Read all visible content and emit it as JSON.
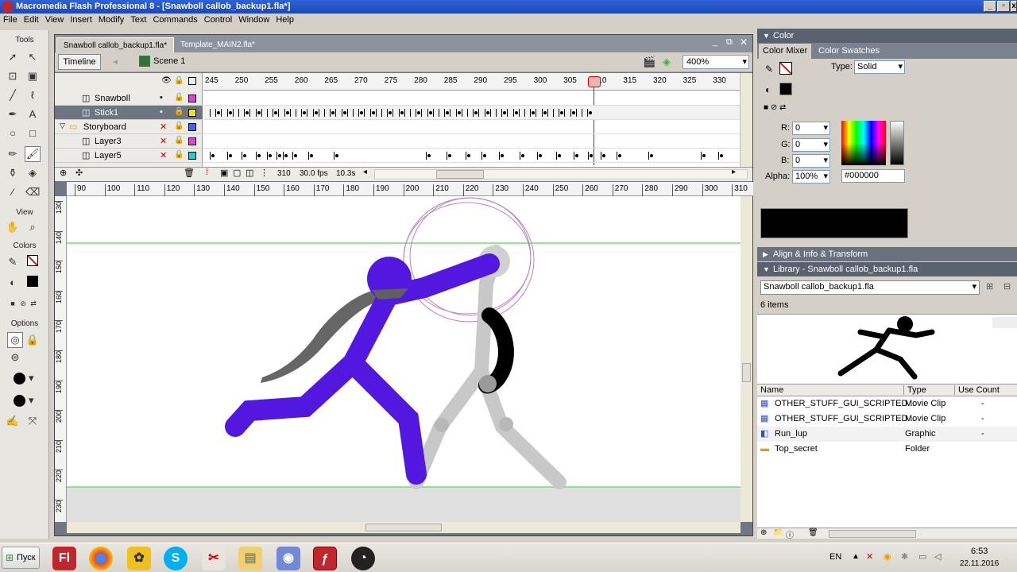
{
  "app": {
    "title": "Macromedia Flash Professional 8 - [Snawboll callob_backup1.fla*]",
    "window_controls": [
      "_",
      "▫",
      "x"
    ]
  },
  "menu": [
    "File",
    "Edit",
    "View",
    "Insert",
    "Modify",
    "Text",
    "Commands",
    "Control",
    "Window",
    "Help"
  ],
  "tools": {
    "label": "Tools",
    "view_label": "View",
    "colors_label": "Colors",
    "options_label": "Options"
  },
  "doc_tabs": [
    "Snawboll callob_backup1.fla*",
    "Template_MAIN2.fla*"
  ],
  "edit_bar": {
    "timeline_button": "Timeline",
    "scene": "Scene 1",
    "zoom": "400%"
  },
  "timeline": {
    "frame_numbers": [
      "245",
      "250",
      "255",
      "260",
      "265",
      "270",
      "275",
      "280",
      "285",
      "290",
      "295",
      "300",
      "305",
      "310",
      "315",
      "320",
      "325",
      "330"
    ],
    "layers": [
      {
        "name": "Snawboll",
        "color": "#e040e0",
        "type": "layer"
      },
      {
        "name": "Stick1",
        "color": "#f0e020",
        "type": "layer",
        "selected": true
      },
      {
        "name": "Storyboard",
        "color": "#4060ff",
        "type": "folder"
      },
      {
        "name": "Layer3",
        "color": "#e040e0",
        "type": "layer"
      },
      {
        "name": "Layer5",
        "color": "#20d0d0",
        "type": "layer"
      }
    ],
    "current_frame": "310",
    "fps": "30.0 fps",
    "time": "10.3s"
  },
  "ruler": {
    "h_ticks": [
      "90",
      "100",
      "110",
      "120",
      "130",
      "140",
      "150",
      "160",
      "170",
      "180",
      "190",
      "200",
      "210",
      "220",
      "230",
      "240",
      "250",
      "260",
      "270",
      "280",
      "290",
      "300",
      "310"
    ],
    "v_ticks": [
      "130",
      "140",
      "150",
      "160",
      "170",
      "180",
      "190",
      "200",
      "210",
      "220",
      "230"
    ]
  },
  "color_panel": {
    "title": "Color",
    "tabs": [
      "Color Mixer",
      "Color Swatches"
    ],
    "type_label": "Type:",
    "type_value": "Solid",
    "r_label": "R:",
    "r": "0",
    "g_label": "G:",
    "g": "0",
    "b_label": "B:",
    "b": "0",
    "alpha_label": "Alpha:",
    "alpha": "100%",
    "hex": "#000000",
    "swatch_color": "#000000"
  },
  "align_panel": {
    "title": "Align & Info & Transform"
  },
  "library": {
    "title": "Library - Snawboll callob_backup1.fla",
    "document": "Snawboll callob_backup1.fla",
    "count": "6 items",
    "columns": [
      "Name",
      "Type",
      "Use Count"
    ],
    "items": [
      {
        "name": "OTHER_STUFF_GUI_SCRIPTED...",
        "type": "Movie Clip",
        "use": "-",
        "icon": "movie-clip-icon"
      },
      {
        "name": "OTHER_STUFF_GUI_SCRIPTED...",
        "type": "Movie Clip",
        "use": "-",
        "icon": "movie-clip-icon"
      },
      {
        "name": "Run_lup",
        "type": "Graphic",
        "use": "-",
        "icon": "graphic-icon"
      },
      {
        "name": "Top_secret",
        "type": "Folder",
        "use": "",
        "icon": "folder-icon"
      }
    ]
  },
  "taskbar": {
    "start": "Пуск",
    "lang": "EN",
    "time": "6:53",
    "date": "22.11.2016"
  }
}
